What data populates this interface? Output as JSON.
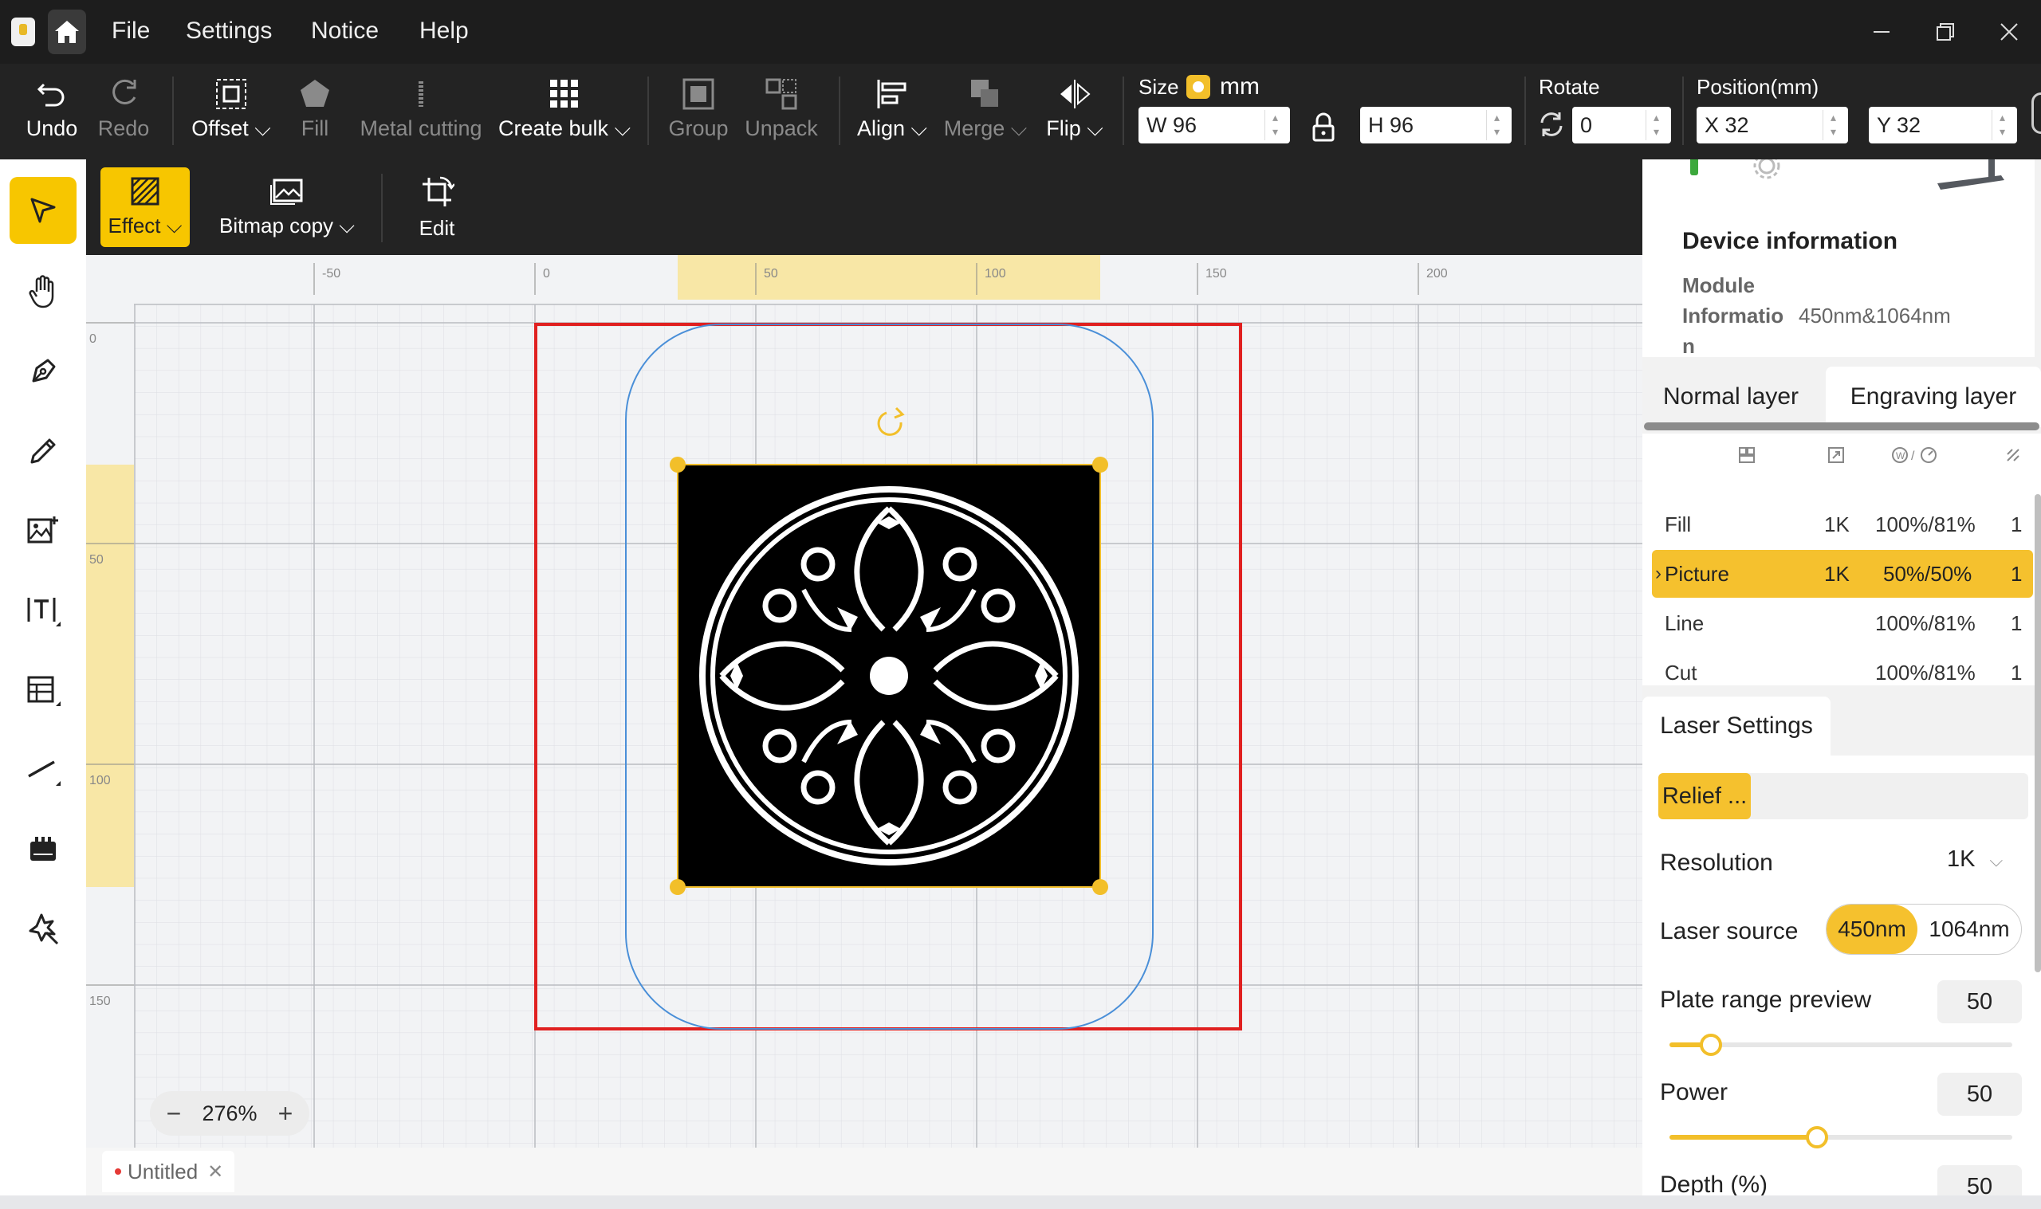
{
  "menu": {
    "file": "File",
    "settings": "Settings",
    "notice": "Notice",
    "help": "Help"
  },
  "toolbar": {
    "undo": "Undo",
    "redo": "Redo",
    "offset": "Offset",
    "fill": "Fill",
    "metal_cutting": "Metal cutting",
    "create_bulk": "Create bulk",
    "group": "Group",
    "unpack": "Unpack",
    "align": "Align",
    "merge": "Merge",
    "flip": "Flip",
    "size_label": "Size",
    "unit": "mm",
    "width": "W 96",
    "height": "H 96",
    "rotate_label": "Rotate",
    "rotate_value": "0",
    "position_label": "Position(mm)",
    "pos_x": "X 32",
    "pos_y": "Y 32"
  },
  "effectbar": {
    "effect": "Effect",
    "bitmap_copy": "Bitmap copy",
    "edit": "Edit"
  },
  "canvas": {
    "ruler_x": [
      "-50",
      "0",
      "50",
      "100",
      "150",
      "200"
    ],
    "ruler_y": [
      "0",
      "50",
      "100",
      "150"
    ],
    "zoom": "276%"
  },
  "document_tab": {
    "name": "Untitled"
  },
  "device": {
    "title": "Device information",
    "module_label_1": "Module",
    "module_label_2": "Informatio",
    "module_label_3": "n",
    "module_value": "450nm&1064nm"
  },
  "layer_tabs": {
    "normal": "Normal layer",
    "engraving": "Engraving layer"
  },
  "layers": [
    {
      "name": "Fill",
      "res": "1K",
      "power_speed": "100%/81%",
      "passes": "1"
    },
    {
      "name": "Picture",
      "res": "1K",
      "power_speed": "50%/50%",
      "passes": "1"
    },
    {
      "name": "Line",
      "res": "",
      "power_speed": "100%/81%",
      "passes": "1"
    },
    {
      "name": "Cut",
      "res": "",
      "power_speed": "100%/81%",
      "passes": "1"
    }
  ],
  "laser": {
    "tab": "Laser Settings",
    "mode": "Relief ...",
    "resolution_label": "Resolution",
    "resolution_value": "1K",
    "source_label": "Laser source",
    "source_a": "450nm",
    "source_b": "1064nm",
    "plate_label": "Plate range preview",
    "plate_value": "50",
    "power_label": "Power",
    "power_value": "50",
    "depth_label": "Depth (%)",
    "depth_value": "50"
  },
  "sliders": {
    "plate_fraction": 0.12,
    "power_fraction": 0.43
  },
  "colors": {
    "accent": "#f5c12e",
    "workarea": "#e02020",
    "bed_outline": "#4a8fd8",
    "selection": "#f2bf2a"
  }
}
